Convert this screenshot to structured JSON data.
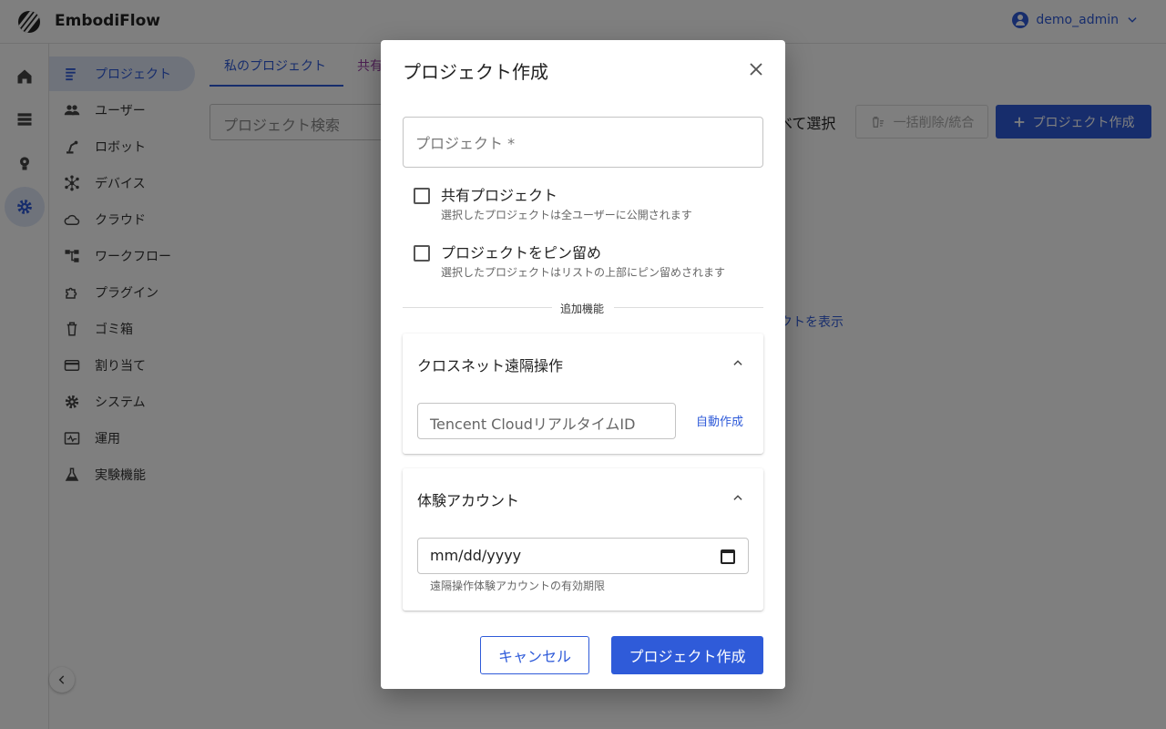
{
  "app": {
    "brand": "EmbodiFlow",
    "user_name": "demo_admin"
  },
  "rail": {
    "icons": [
      "home-icon",
      "list-icon",
      "lightbulb-icon",
      "gear-icon"
    ]
  },
  "sidebar": {
    "items": [
      {
        "label": "プロジェクト",
        "icon": "project-list-icon"
      },
      {
        "label": "ユーザー",
        "icon": "users-icon"
      },
      {
        "label": "ロボット",
        "icon": "robot-arm-icon"
      },
      {
        "label": "デバイス",
        "icon": "device-hub-icon"
      },
      {
        "label": "クラウド",
        "icon": "cloud-icon"
      },
      {
        "label": "ワークフロー",
        "icon": "workflow-icon"
      },
      {
        "label": "プラグイン",
        "icon": "puzzle-icon"
      },
      {
        "label": "ゴミ箱",
        "icon": "trash-icon"
      },
      {
        "label": "割り当て",
        "icon": "credit-card-icon"
      },
      {
        "label": "システム",
        "icon": "gear-icon"
      },
      {
        "label": "運用",
        "icon": "monitor-icon"
      },
      {
        "label": "実験機能",
        "icon": "flask-icon"
      }
    ]
  },
  "tabs": {
    "my_projects": "私のプロジェクト",
    "shared": "共有"
  },
  "toolbar": {
    "search_placeholder": "プロジェクト検索",
    "select_all": "べて選択",
    "bulk_delete": "一括削除/統合",
    "create_project": "プロジェクト作成"
  },
  "content": {
    "show_link": "クトを表示"
  },
  "dialog": {
    "title": "プロジェクト作成",
    "project_field_label": "プロジェクト *",
    "shared": {
      "label": "共有プロジェクト",
      "description": "選択したプロジェクトは全ユーザーに公開されます",
      "checked": false
    },
    "pin": {
      "label": "プロジェクトをピン留め",
      "description": "選択したプロジェクトはリストの上部にピン留めされます",
      "checked": false
    },
    "divider_label": "追加機能",
    "crossnet": {
      "title": "クロスネット遠隔操作",
      "input_placeholder": "Tencent CloudリアルタイムID",
      "auto_button": "自動作成"
    },
    "trial": {
      "title": "体験アカウント",
      "date_placeholder": "mm/dd/yyyy",
      "help": "遠隔操作体験アカウントの有効期限"
    },
    "cancel_label": "キャンセル",
    "submit_label": "プロジェクト作成"
  },
  "colors": {
    "primary": "#2f5bd9",
    "overlay": "rgba(0,0,0,0.5)"
  }
}
